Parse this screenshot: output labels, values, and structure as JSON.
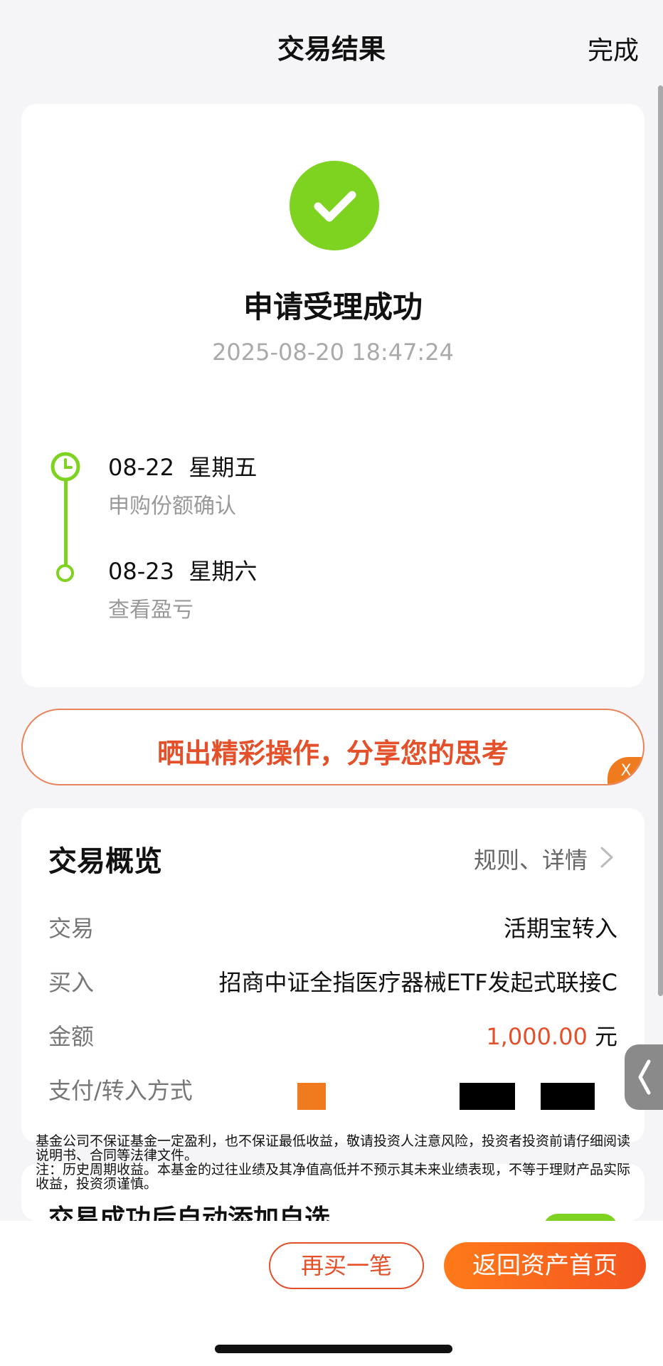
{
  "header": {
    "title": "交易结果",
    "done_label": "完成"
  },
  "result": {
    "status": "申请受理成功",
    "time": "2025-08-20 18:47:24",
    "timeline": [
      {
        "date": "08-22  星期五",
        "desc": "申购份额确认"
      },
      {
        "date": "08-23  星期六",
        "desc": "查看盈亏"
      }
    ]
  },
  "share_banner": {
    "text": "晒出精彩操作，分享您的思考",
    "close_label": "X"
  },
  "overview": {
    "title": "交易概览",
    "rules_link": "规则、详情",
    "rows": [
      {
        "label": "交易",
        "value": "活期宝转入"
      },
      {
        "label": "买入",
        "value": "招商中证全指医疗器械ETF发起式联接C"
      },
      {
        "label": "金额",
        "amount": "1,000.00",
        "unit": "元"
      },
      {
        "label": "支付/转入方式"
      }
    ]
  },
  "disclaimer": {
    "line1": "基金公司不保证基金一定盈利，也不保证最低收益，敬请投资人注意风险，投资者投资前请仔细阅读说明书、合同等法律文件。",
    "line2": "注：历史周期收益。本基金的过往业绩及其净值高低并不预示其未来业绩表现，不等于理财产品实际收益，投资须谨慎。"
  },
  "auto_add": {
    "label": "交易成功后自动添加自选",
    "enabled": true
  },
  "bottom": {
    "buy_again": "再买一笔",
    "back_home": "返回资产首页"
  },
  "colors": {
    "accent_orange": "#e4502a",
    "success_green": "#7ed321"
  },
  "icons": [
    "check-icon",
    "clock-icon",
    "chevron-right-icon",
    "close-icon"
  ]
}
